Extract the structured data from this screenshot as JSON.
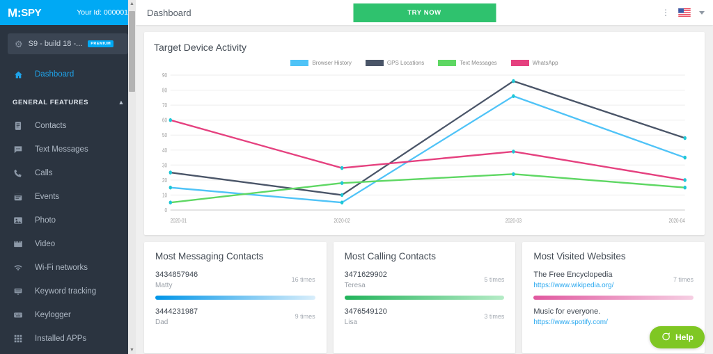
{
  "brand": {
    "logo_m": "M:",
    "logo_text": "SPY",
    "user_id": "Your Id: 000001"
  },
  "sidebar": {
    "device": {
      "icon": "android-icon",
      "name": "S9 - build 18 -...",
      "badge": "PREMIUM"
    },
    "dashboard": {
      "label": "Dashboard",
      "icon": "home-icon"
    },
    "section": {
      "label": "GENERAL FEATURES",
      "chevron": "chevron-up-icon"
    },
    "items": [
      {
        "label": "Contacts",
        "icon": "contacts-icon"
      },
      {
        "label": "Text Messages",
        "icon": "message-icon"
      },
      {
        "label": "Calls",
        "icon": "phone-icon"
      },
      {
        "label": "Events",
        "icon": "calendar-icon"
      },
      {
        "label": "Photo",
        "icon": "image-icon"
      },
      {
        "label": "Video",
        "icon": "video-icon"
      },
      {
        "label": "Wi-Fi networks",
        "icon": "wifi-icon"
      },
      {
        "label": "Keyword tracking",
        "icon": "keyword-icon"
      },
      {
        "label": "Keylogger",
        "icon": "keyboard-icon"
      },
      {
        "label": "Installed APPs",
        "icon": "grid-icon"
      }
    ]
  },
  "topbar": {
    "page_title": "Dashboard",
    "try_now": "TRY NOW",
    "kebab_icon": "more-vertical-icon",
    "flag_icon": "us-flag-icon",
    "caret_icon": "chevron-down-icon"
  },
  "chart_data": {
    "type": "line",
    "title": "Target Device Activity",
    "xlabel": "",
    "ylabel": "",
    "categories": [
      "2020-01",
      "2020-02",
      "2020-03",
      "2020-04"
    ],
    "yticks": [
      0,
      10,
      20,
      30,
      40,
      50,
      60,
      70,
      80,
      90
    ],
    "ylim": [
      0,
      90
    ],
    "grid": true,
    "legend_position": "top-center",
    "series": [
      {
        "name": "Browser History",
        "color": "#4fc3f7",
        "values": [
          15,
          5,
          76,
          35
        ]
      },
      {
        "name": "GPS Locations",
        "color": "#4a5568",
        "values": [
          25,
          10,
          86,
          48
        ]
      },
      {
        "name": "Text Messages",
        "color": "#5ed763",
        "values": [
          5,
          18,
          24,
          15
        ]
      },
      {
        "name": "WhatsApp",
        "color": "#e5417f",
        "values": [
          60,
          28,
          39,
          20
        ]
      }
    ],
    "marker_color": "#1ec8d6"
  },
  "cards": [
    {
      "title": "Most Messaging Contacts",
      "bar_class": "bar-blue",
      "items": [
        {
          "main": "3434857946",
          "sub": "Matty",
          "count": "16 times",
          "sub_is_link": false
        },
        {
          "main": "3444231987",
          "sub": "Dad",
          "count": "9 times",
          "sub_is_link": false
        }
      ]
    },
    {
      "title": "Most Calling Contacts",
      "bar_class": "bar-green",
      "items": [
        {
          "main": "3471629902",
          "sub": "Teresa",
          "count": "5 times",
          "sub_is_link": false
        },
        {
          "main": "3476549120",
          "sub": "Lisa",
          "count": "3 times",
          "sub_is_link": false
        }
      ]
    },
    {
      "title": "Most Visited Websites",
      "bar_class": "bar-pink",
      "items": [
        {
          "main": "The Free Encyclopedia",
          "sub": "https://www.wikipedia.org/",
          "count": "7 times",
          "sub_is_link": true
        },
        {
          "main": "Music for everyone.",
          "sub": "https://www.spotify.com/",
          "count": "",
          "sub_is_link": true
        }
      ]
    }
  ],
  "help": {
    "label": "Help",
    "icon": "chat-bubble-icon"
  }
}
